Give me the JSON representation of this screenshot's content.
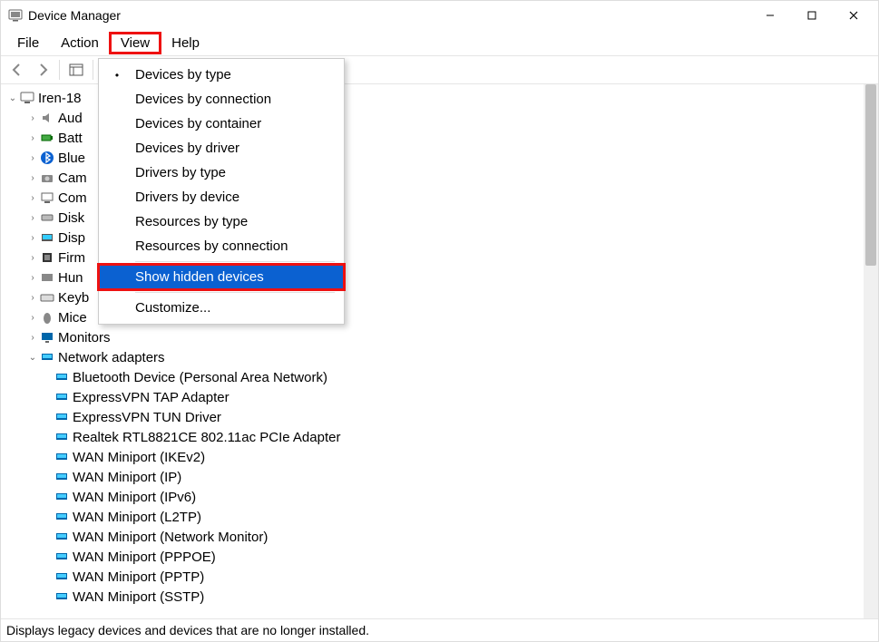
{
  "window": {
    "title": "Device Manager"
  },
  "menus": {
    "file": "File",
    "action": "Action",
    "view": "View",
    "help": "Help"
  },
  "view_menu": {
    "devices_by_type": "Devices by type",
    "devices_by_connection": "Devices by connection",
    "devices_by_container": "Devices by container",
    "devices_by_driver": "Devices by driver",
    "drivers_by_type": "Drivers by type",
    "drivers_by_device": "Drivers by device",
    "resources_by_type": "Resources by type",
    "resources_by_connection": "Resources by connection",
    "show_hidden": "Show hidden devices",
    "customize": "Customize..."
  },
  "tree": {
    "root": "Iren-18",
    "cats": {
      "audio": "Aud",
      "batteries": "Batt",
      "bluetooth": "Blue",
      "cameras": "Cam",
      "computer": "Com",
      "disk": "Disk",
      "display": "Disp",
      "firmware": "Firm",
      "hid": "Hun",
      "keyboards": "Keyb",
      "mice": "Mice",
      "monitors": "Monitors",
      "network": "Network adapters"
    },
    "net": [
      "Bluetooth Device (Personal Area Network)",
      "ExpressVPN TAP Adapter",
      "ExpressVPN TUN Driver",
      "Realtek RTL8821CE 802.11ac PCIe Adapter",
      "WAN Miniport (IKEv2)",
      "WAN Miniport (IP)",
      "WAN Miniport (IPv6)",
      "WAN Miniport (L2TP)",
      "WAN Miniport (Network Monitor)",
      "WAN Miniport (PPPOE)",
      "WAN Miniport (PPTP)",
      "WAN Miniport (SSTP)"
    ]
  },
  "statusbar": "Displays legacy devices and devices that are no longer installed."
}
